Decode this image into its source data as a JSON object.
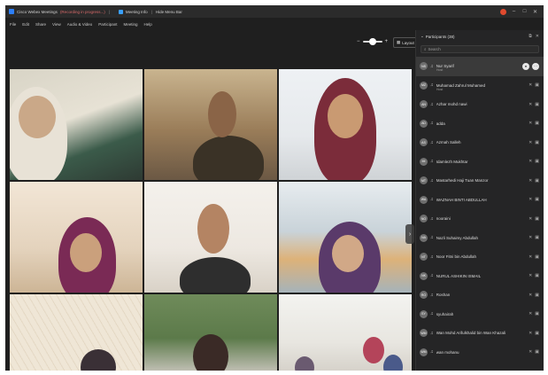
{
  "titlebar": {
    "app_title": "Cisco Webex Meetings",
    "recording": "(Recording in progress...)",
    "meeting_info": "Meeting Info",
    "hide_menu_bar": "Hide Menu Bar",
    "window_buttons": [
      "–",
      "□",
      "✕"
    ]
  },
  "menubar": {
    "items": [
      "File",
      "Edit",
      "Share",
      "View",
      "Audio & Video",
      "Participant",
      "Meeting",
      "Help"
    ]
  },
  "toolbar": {
    "layout_label": "Layout"
  },
  "panel": {
    "title": "Participants (38)",
    "search_placeholder": "Search",
    "participants": [
      {
        "initials": "NS",
        "name": "Nur Syarif",
        "sub": "Host",
        "selected": true
      },
      {
        "initials": "MZ",
        "name": "Muhamad Zahrul Muhamed",
        "sub": "Host"
      },
      {
        "initials": "AN",
        "name": "Azhar mohd nawi",
        "sub": ""
      },
      {
        "initials": "AD",
        "name": "adda",
        "sub": ""
      },
      {
        "initials": "AS",
        "name": "Azmah Salleh",
        "sub": ""
      },
      {
        "initials": "IM",
        "name": "Idamlezh Mukhtar",
        "sub": ""
      },
      {
        "initials": "MT",
        "name": "Mastarhedi Haji Tuan Manzor",
        "sub": ""
      },
      {
        "initials": "WA",
        "name": "WAZNAH BINTI ABDULLAH",
        "sub": ""
      },
      {
        "initials": "NO",
        "name": "nooraini",
        "sub": ""
      },
      {
        "initials": "NA",
        "name": "Nazli Suhaimy Abdullah",
        "sub": ""
      },
      {
        "initials": "NT",
        "name": "Noor Fitni bin Abdullah",
        "sub": ""
      },
      {
        "initials": "NK",
        "name": "NURUL ASHIKIN ISMAIL",
        "sub": ""
      },
      {
        "initials": "RO",
        "name": "Roshan",
        "sub": ""
      },
      {
        "initials": "SY",
        "name": "syuhairah",
        "sub": ""
      },
      {
        "initials": "WM",
        "name": "Wan Mohd Arifulkhalid bin Wan Khazali",
        "sub": ""
      },
      {
        "initials": "WM",
        "name": "wan mohanu",
        "sub": ""
      }
    ]
  },
  "colors": {
    "background": "#1f1f1f",
    "panel": "#252526",
    "accent": "#2d7ff9"
  }
}
